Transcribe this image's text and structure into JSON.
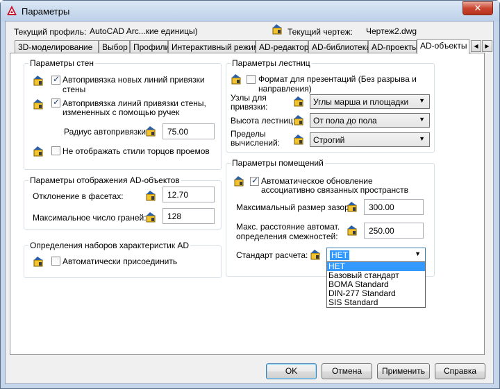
{
  "window": {
    "title": "Параметры",
    "close_label": "✕"
  },
  "profile": {
    "current_profile_label": "Текущий профиль:",
    "current_profile_value": "AutoCAD Arc...кие единицы)",
    "current_drawing_label": "Текущий чертеж:",
    "current_drawing_value": "Чертеж2.dwg"
  },
  "tabs": [
    "3D-моделирование",
    "Выбор",
    "Профили",
    "Интерактивный режим",
    "AD-редактор",
    "AD-библиотека",
    "AD-проекты",
    "AD-объекты"
  ],
  "active_tab": "AD-объекты",
  "wall_params": {
    "title": "Параметры стен",
    "snap_new_lines": {
      "label1": "Автопривязка новых линий привязки",
      "label2": "стены",
      "checked": true
    },
    "snap_changed_lines": {
      "label1": "Автопривязка линий привязки стены,",
      "label2": "измененных с помощью ручек",
      "checked": true
    },
    "snap_radius_label": "Радиус автопривязки:",
    "snap_radius_value": "75.00",
    "hide_opening_styles": {
      "label": "Не отображать стили торцов проемов",
      "checked": false
    }
  },
  "display_params": {
    "title": "Параметры отображения AD-объектов",
    "facet_dev_label": "Отклонение в фасетах:",
    "facet_dev_value": "12.70",
    "max_faces_label": "Максимальное число граней:",
    "max_faces_value": "128"
  },
  "propsets": {
    "title": "Определения наборов характеристик AD",
    "auto_attach": {
      "label": "Автоматически присоединить",
      "checked": false
    }
  },
  "stair_params": {
    "title": "Параметры лестниц",
    "presentation_format": {
      "label1": "Формат для презентаций (Без разрыва и",
      "label2": "направления)",
      "checked": false
    },
    "snap_nodes_label1": "Узлы для",
    "snap_nodes_label2": "привязки:",
    "snap_nodes_value": "Углы марша и площадки",
    "height_label": "Высота лестниц:",
    "height_value": "От пола до пола",
    "limits_label1": "Пределы",
    "limits_label2": "вычислений:",
    "limits_value": "Строгий"
  },
  "space_params": {
    "title": "Параметры помещений",
    "auto_update": {
      "label1": "Автоматическое обновление",
      "label2": "ассоциативно связанных пространств",
      "checked": true
    },
    "max_gap_label": "Максимальный размер зазора:",
    "max_gap_value": "300.00",
    "max_adj_label1": "Макс. расстояние автомат.",
    "max_adj_label2": "определения смежностей:",
    "max_adj_value": "250.00",
    "calc_std_label": "Стандарт расчета:",
    "calc_std_value": "НЕТ",
    "calc_std_options": [
      "НЕТ",
      "Базовый стандарт",
      "BOMA Standard",
      "DIN-277 Standard",
      "SIS Standard"
    ]
  },
  "buttons": {
    "ok": "OK",
    "cancel": "Отмена",
    "apply": "Применить",
    "help": "Справка"
  }
}
